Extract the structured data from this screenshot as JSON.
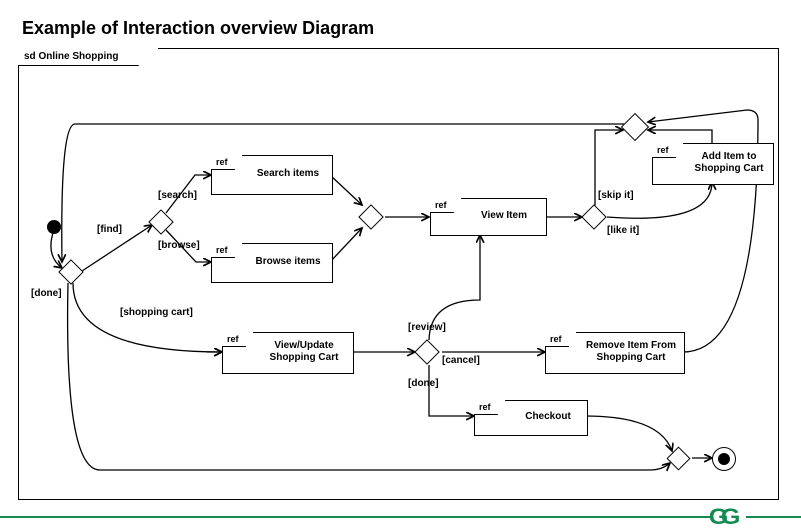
{
  "title": "Example of Interaction overview Diagram",
  "frame_title": "sd Online Shopping",
  "nodes": {
    "search": {
      "kind": "ref",
      "label": "Search items"
    },
    "browse": {
      "kind": "ref",
      "label": "Browse items"
    },
    "view": {
      "kind": "ref",
      "label": "View Item"
    },
    "addcart": {
      "kind": "ref",
      "label": "Add Item to\nShopping Cart"
    },
    "viewcart": {
      "kind": "ref",
      "label": "View/Update\nShopping Cart"
    },
    "remove": {
      "kind": "ref",
      "label": "Remove Item From\nShopping Cart"
    },
    "checkout": {
      "kind": "ref",
      "label": "Checkout"
    }
  },
  "guards": {
    "find": "[find]",
    "done1": "[done]",
    "search": "[search]",
    "browse": "[browse]",
    "cart": "[shopping cart]",
    "skipit": "[skip it]",
    "likeit": "[like it]",
    "review": "[review]",
    "cancel": "[cancel]",
    "done2": "[done]"
  },
  "ref_tag": "ref",
  "logo_text": "GG"
}
